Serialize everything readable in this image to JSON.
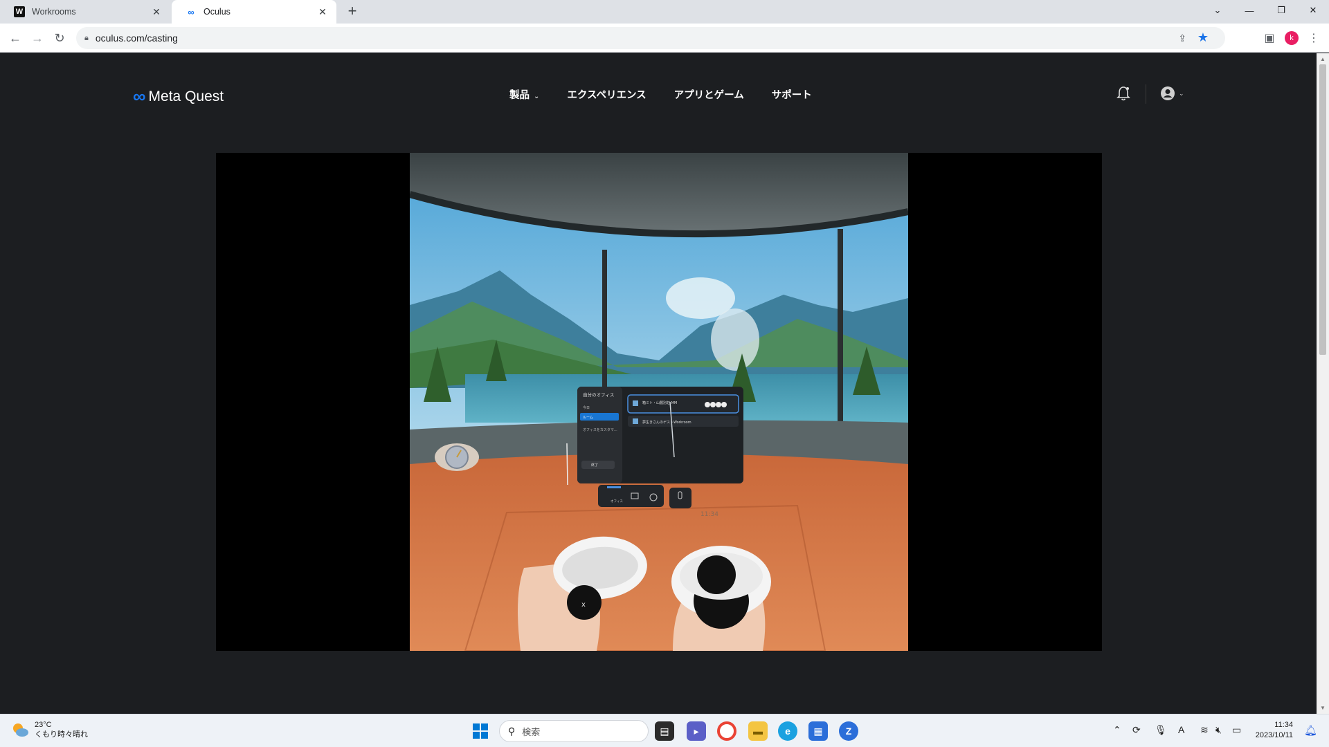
{
  "browser": {
    "tabs": [
      {
        "title": "Workrooms",
        "favicon": "W",
        "active": false
      },
      {
        "title": "Oculus",
        "favicon": "meta-logo",
        "active": true
      }
    ],
    "address": {
      "url": "oculus.com/casting"
    },
    "profile_initial": "k"
  },
  "site": {
    "logo_text": "Meta Quest",
    "nav": [
      {
        "label": "製品",
        "has_dropdown": true
      },
      {
        "label": "エクスペリエンス"
      },
      {
        "label": "アプリとゲーム"
      },
      {
        "label": "サポート"
      }
    ]
  },
  "vr_panel": {
    "title": "自分のオフィス",
    "side_items": [
      "今日",
      "ルーム",
      "オフィスをカスタマ..."
    ],
    "exit_label": "終了",
    "rooms": [
      {
        "name": "箱ミト・山麓別荘 MM"
      },
      {
        "name": "夢生きさんのゲストWorkroom"
      }
    ],
    "dock_label": "オフィス",
    "time": "11:34"
  },
  "taskbar": {
    "weather_temp": "23°C",
    "weather_desc": "くもり時々晴れ",
    "search_placeholder": "検索",
    "time": "11:34",
    "date": "2023/10/11"
  },
  "colors": {
    "page_bg": "#1c1e21",
    "meta_blue": "#1877f2",
    "chrome_star": "#1a73e8"
  }
}
